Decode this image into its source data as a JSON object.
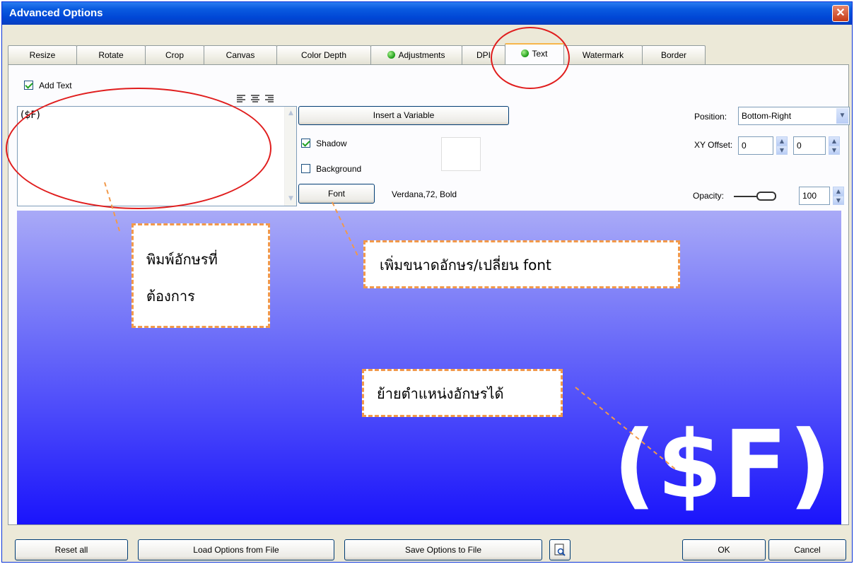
{
  "window": {
    "title": "Advanced Options",
    "close_glyph": "✕"
  },
  "tabs": [
    {
      "label": "Resize",
      "icon": ""
    },
    {
      "label": "Rotate",
      "icon": ""
    },
    {
      "label": "Crop",
      "icon": ""
    },
    {
      "label": "Canvas",
      "icon": ""
    },
    {
      "label": "Color Depth",
      "icon": ""
    },
    {
      "label": "Adjustments",
      "icon": "green-dot-icon"
    },
    {
      "label": "DPI",
      "icon": ""
    },
    {
      "label": "Text",
      "icon": "green-dot-icon",
      "active": true
    },
    {
      "label": "Watermark",
      "icon": ""
    },
    {
      "label": "Border",
      "icon": ""
    }
  ],
  "text_panel": {
    "add_text_label": "Add Text",
    "add_text_checked": true,
    "text_value": "($F)",
    "insert_variable_label": "Insert a Variable",
    "shadow_label": "Shadow",
    "shadow_checked": true,
    "background_label": "Background",
    "background_checked": false,
    "font_button_label": "Font",
    "font_info": "Verdana,72, Bold",
    "swatch_color": "#ffffff"
  },
  "position": {
    "position_label": "Position:",
    "position_value": "Bottom-Right",
    "xy_offset_label": "XY Offset:",
    "x_value": "0",
    "y_value": "0",
    "opacity_label": "Opacity:",
    "opacity_value": "100"
  },
  "preview": {
    "text": "($F)",
    "gradient_top": "#a9aaf7",
    "gradient_bottom": "#1a14fb"
  },
  "annotations": {
    "type_text": [
      "พิมพ์อักษรที่",
      "ต้องการ"
    ],
    "font_size": "เพิ่มขนาดอักษร/เปลี่ยน font",
    "move_position": "ย้ายตำแหน่งอักษรได้"
  },
  "footer": {
    "reset_label": "Reset all",
    "load_label": "Load Options from File",
    "save_label": "Save Options to File",
    "ok_label": "OK",
    "cancel_label": "Cancel"
  },
  "colors": {
    "titlebar": "#0a5be0",
    "annotation_border": "#f2994a",
    "annotation_ring": "#e01d1d"
  }
}
